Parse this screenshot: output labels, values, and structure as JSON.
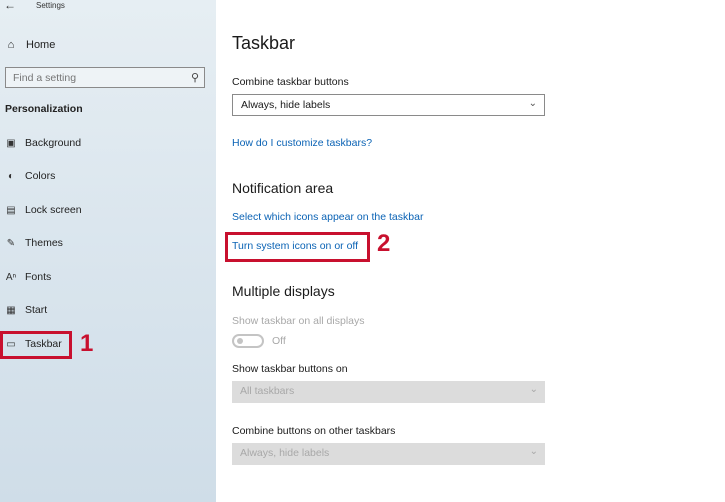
{
  "window": {
    "title": "Settings",
    "back_icon": "back-arrow-icon"
  },
  "sidebar": {
    "home": {
      "label": "Home",
      "icon": "home-icon"
    },
    "search": {
      "placeholder": "Find a setting",
      "icon": "search-icon"
    },
    "group_label": "Personalization",
    "items": [
      {
        "label": "Background",
        "icon": "image-icon"
      },
      {
        "label": "Colors",
        "icon": "palette-icon"
      },
      {
        "label": "Lock screen",
        "icon": "lock-screen-icon"
      },
      {
        "label": "Themes",
        "icon": "brush-icon"
      },
      {
        "label": "Fonts",
        "icon": "font-icon"
      },
      {
        "label": "Start",
        "icon": "start-icon"
      },
      {
        "label": "Taskbar",
        "icon": "taskbar-icon",
        "selected": true
      }
    ]
  },
  "annotations": {
    "marker_1": "1",
    "marker_2": "2",
    "highlight_color": "#c8102e"
  },
  "main": {
    "title": "Taskbar",
    "combine": {
      "label": "Combine taskbar buttons",
      "value": "Always, hide labels"
    },
    "customize_link": "How do I customize taskbars?",
    "notification": {
      "heading": "Notification area",
      "link_icons": "Select which icons appear on the taskbar",
      "link_system": "Turn system icons on or off"
    },
    "multiple": {
      "heading": "Multiple displays",
      "show_all_label": "Show taskbar on all displays",
      "toggle_state": "Off",
      "show_buttons_label": "Show taskbar buttons on",
      "show_buttons_value": "All taskbars",
      "combine_other_label": "Combine buttons on other taskbars",
      "combine_other_value": "Always, hide labels"
    }
  },
  "colors": {
    "link": "#0b63b5",
    "accent_red": "#c8102e",
    "disabled": "#a8a8a8"
  }
}
